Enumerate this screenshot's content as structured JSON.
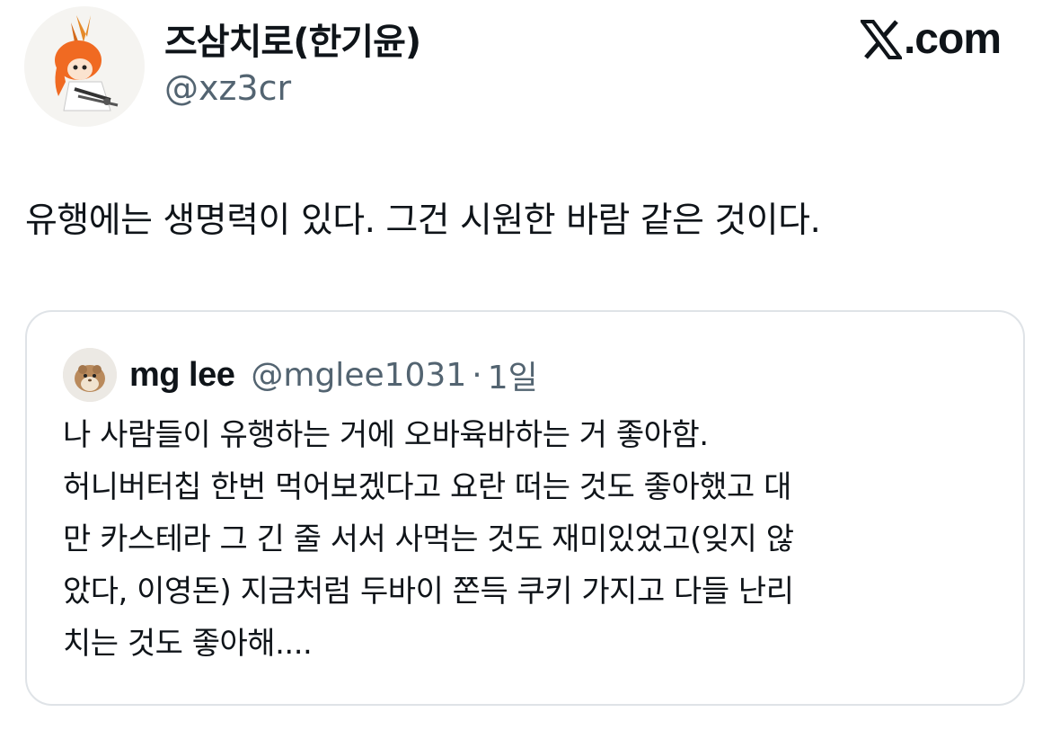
{
  "author": {
    "name": "즈삼치로(한기윤)",
    "handle": "@xz3cr",
    "avatar_icon": "anime-character-avatar-icon"
  },
  "brand": {
    "logo_icon": "x-logo-icon",
    "domain": ".com"
  },
  "tweet": {
    "text": "유행에는 생명력이 있다. 그건 시원한 바람 같은 것이다."
  },
  "quote": {
    "avatar_icon": "hamster-avatar-icon",
    "name": "mg lee",
    "handle": "@mglee1031",
    "separator": "·",
    "time": "1일",
    "lines": [
      "나 사람들이 유행하는 거에 오바육바하는 거 좋아함.",
      "허니버터칩 한번 먹어보겠다고 요란 떠는 것도 좋아했고 대",
      "만 카스테라 그 긴 줄 서서 사먹는 것도 재미있었고(잊지 않",
      "았다, 이영돈) 지금처럼 두바이 쫀득 쿠키 가지고 다들 난리",
      "치는 것도 좋아해...."
    ]
  },
  "colors": {
    "text": "#0f1419",
    "secondary": "#536471",
    "border": "#dfe3e7"
  }
}
